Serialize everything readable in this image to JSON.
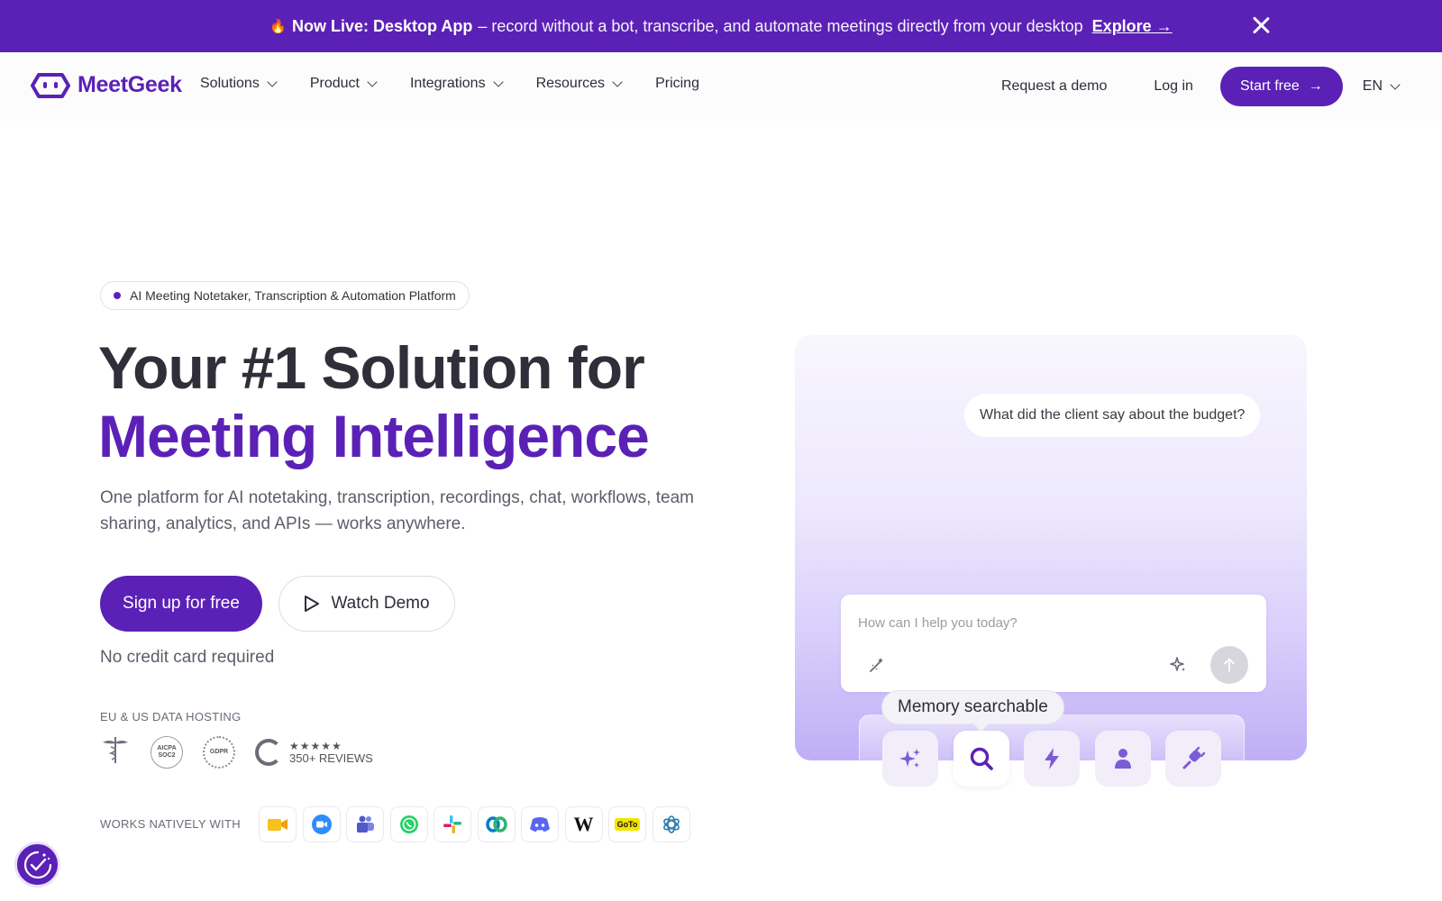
{
  "banner": {
    "highlight": "Now Live: Desktop App",
    "text": "– record without a bot, transcribe, and automate meetings directly from your desktop",
    "cta": "Explore →"
  },
  "nav": {
    "brand": "MeetGeek",
    "links": [
      {
        "label": "Solutions",
        "has_dropdown": true
      },
      {
        "label": "Product",
        "has_dropdown": true
      },
      {
        "label": "Integrations",
        "has_dropdown": true
      },
      {
        "label": "Resources",
        "has_dropdown": true
      },
      {
        "label": "Pricing",
        "has_dropdown": false
      }
    ],
    "request_demo": "Request a demo",
    "login": "Log in",
    "start_free": "Start free",
    "start_free_arrow": "→",
    "language": "EN"
  },
  "hero": {
    "pill": "AI Meeting Notetaker, Transcription & Automation Platform",
    "title_line1": "Your #1 Solution for",
    "title_line2": "Meeting Intelligence",
    "subtitle": "One platform for AI notetaking, transcription, recordings, chat, workflows, team sharing, analytics, and APIs — works anywhere.",
    "signup": "Sign up for free",
    "watch_demo": "Watch Demo",
    "no_credit_card": "No credit card required",
    "hosting_label": "EU & US DATA HOSTING",
    "badges": {
      "aicpa_line1": "AICPA",
      "aicpa_line2": "SOC2",
      "gdpr": "GDPR",
      "stars": "★★★★★",
      "reviews": "350+ REVIEWS"
    },
    "works_label": "WORKS NATIVELY WITH",
    "apps": [
      "google-meet-icon",
      "zoom-icon",
      "teams-icon",
      "whatsapp-icon",
      "slack-icon",
      "webex-icon",
      "discord-icon",
      "wix-icon",
      "goto-icon",
      "perplexity-icon"
    ],
    "goto_label": "GoTo",
    "wix_label": "W"
  },
  "demo_card": {
    "question": "What did the client say about the budget?",
    "input_placeholder": "How can I help you today?",
    "tooltip": "Memory searchable",
    "tools": [
      "sparkles-icon",
      "search-icon",
      "lightning-icon",
      "person-icon",
      "plug-icon"
    ],
    "active_tool": "search-icon"
  },
  "colors": {
    "brand": "#5b21b6",
    "banner_bg": "#5b21b6",
    "heading": "#2f2f3a"
  }
}
